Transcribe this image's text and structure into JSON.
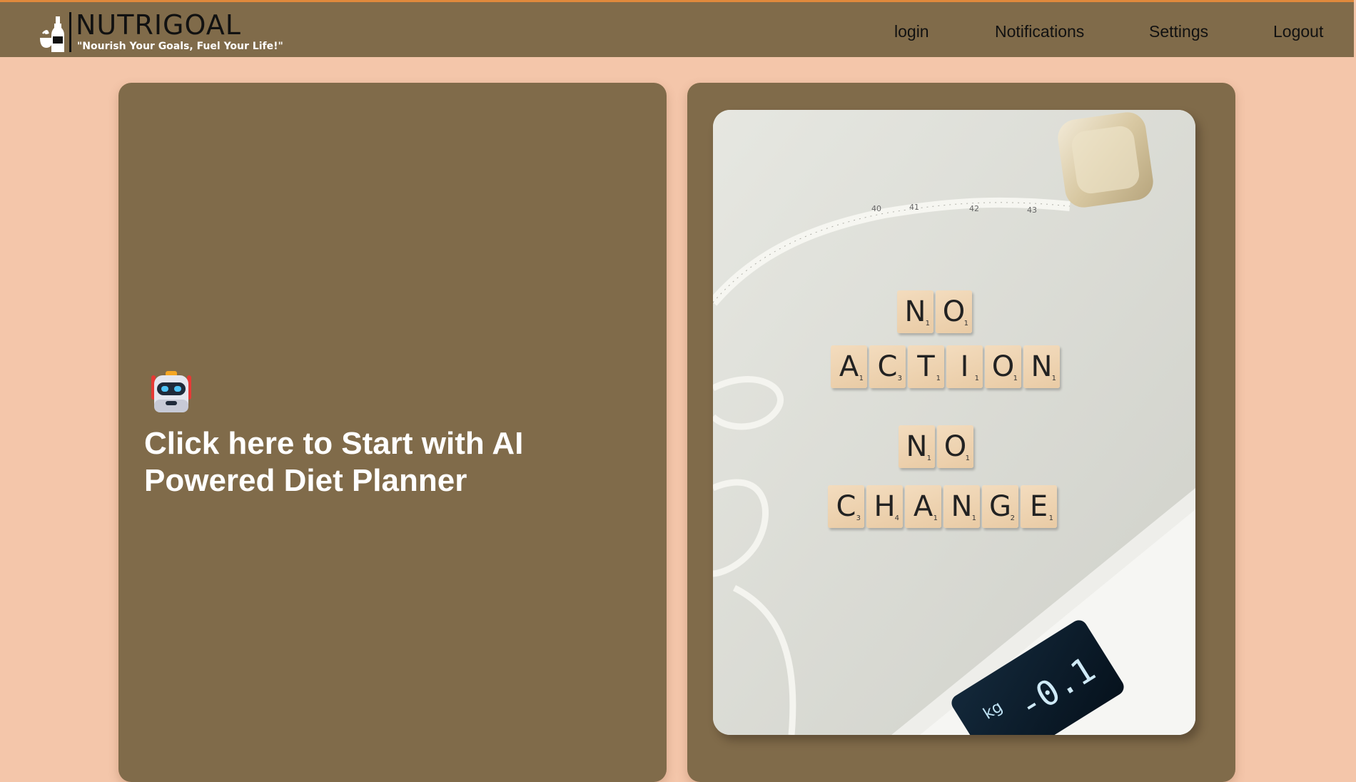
{
  "header": {
    "brand_name": "NUTRIGOAL",
    "brand_tagline": "\"Nourish Your Goals, Fuel Your Life!\"",
    "nav": {
      "login": "login",
      "notifications": "Notifications",
      "settings": "Settings",
      "logout": "Logout"
    }
  },
  "cta_card": {
    "icon": "robot-icon",
    "text": "Click here to Start with AI Powered Diet Planner"
  },
  "image_card": {
    "photo_subject": "scrabble-tiles-measuring-tape-scale",
    "tiles": {
      "row1": [
        [
          "N",
          "1"
        ],
        [
          "O",
          "1"
        ]
      ],
      "row2": [
        [
          "A",
          "1"
        ],
        [
          "C",
          "3"
        ],
        [
          "T",
          "1"
        ],
        [
          "I",
          "1"
        ],
        [
          "O",
          "1"
        ],
        [
          "N",
          "1"
        ]
      ],
      "row3": [
        [
          "N",
          "1"
        ],
        [
          "O",
          "1"
        ]
      ],
      "row4": [
        [
          "C",
          "3"
        ],
        [
          "H",
          "4"
        ],
        [
          "A",
          "1"
        ],
        [
          "N",
          "1"
        ],
        [
          "G",
          "2"
        ],
        [
          "E",
          "1"
        ]
      ]
    },
    "tape_marks": [
      "40",
      "41",
      "42",
      "43"
    ],
    "scale_unit": "kg",
    "scale_reading": "-0.1"
  },
  "colors": {
    "page_background": "#f4c6aa",
    "navbar_background": "#806b4a",
    "navbar_top_accent": "#e0893c",
    "card_background": "#806b4a",
    "cta_text": "#ffffff"
  }
}
